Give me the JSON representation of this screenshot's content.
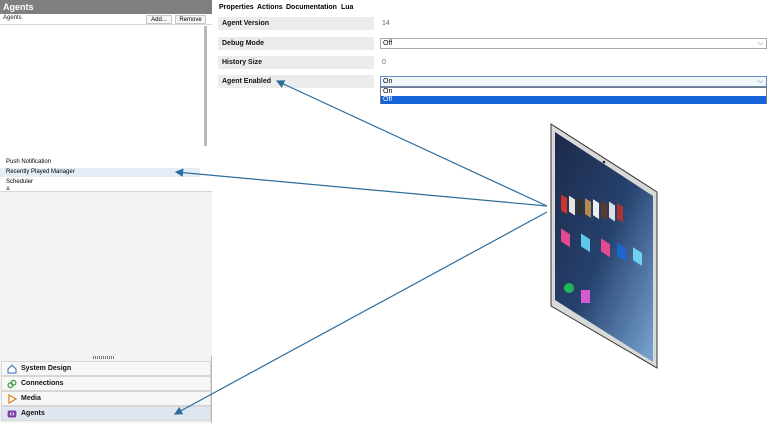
{
  "agents_panel": {
    "header": "Agents",
    "column_label": "Agents",
    "add_label": "Add...",
    "remove_label": "Remove",
    "items": [
      {
        "label": "Push Notification"
      },
      {
        "label": "Recently Played Manager"
      },
      {
        "label": "Scheduler"
      },
      {
        "label": "A..."
      }
    ]
  },
  "nav": {
    "system_design": "System Design",
    "connections": "Connections",
    "media": "Media",
    "agents": "Agents"
  },
  "tabs": {
    "properties": "Properties",
    "actions": "Actions",
    "documentation": "Documentation",
    "lua": "Lua"
  },
  "properties": {
    "agent_version": {
      "label": "Agent Version",
      "value": "14"
    },
    "debug_mode": {
      "label": "Debug Mode",
      "value": "Off"
    },
    "history_size": {
      "label": "History Size",
      "value": "0"
    },
    "agent_enabled": {
      "label": "Agent Enabled",
      "value": "On",
      "options": [
        "On",
        "Off"
      ],
      "highlighted": "Off"
    }
  },
  "colors": {
    "arrow": "#2f6d9a",
    "selection": "#1563d8",
    "header_bg": "#7f7f7f"
  }
}
